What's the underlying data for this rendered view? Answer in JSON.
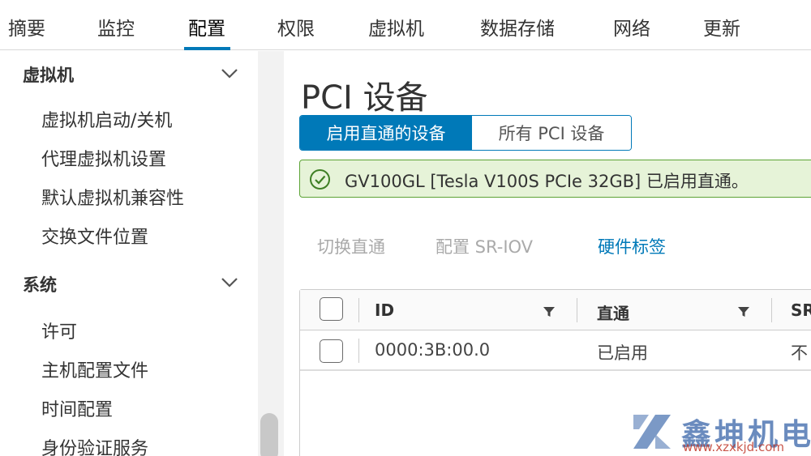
{
  "top_tabs": [
    {
      "label": "摘要"
    },
    {
      "label": "监控"
    },
    {
      "label": "配置",
      "active": true
    },
    {
      "label": "权限"
    },
    {
      "label": "虚拟机"
    },
    {
      "label": "数据存储"
    },
    {
      "label": "网络"
    },
    {
      "label": "更新"
    }
  ],
  "sidebar": {
    "groups": [
      {
        "title": "虚拟机",
        "expanded": true,
        "items": [
          "虚拟机启动/关机",
          "代理虚拟机设置",
          "默认虚拟机兼容性",
          "交换文件位置"
        ]
      },
      {
        "title": "系统",
        "expanded": true,
        "items": [
          "许可",
          "主机配置文件",
          "时间配置",
          "身份验证服务"
        ]
      }
    ]
  },
  "main": {
    "title": "PCI 设备",
    "segmented": {
      "active": "启用直通的设备",
      "inactive": "所有 PCI 设备"
    },
    "alert": {
      "icon": "check-circle-icon",
      "text": "GV100GL [Tesla V100S PCIe 32GB] 已启用直通。"
    },
    "actions": {
      "toggle_passthrough": "切换直通",
      "configure_sriov": "配置 SR-IOV",
      "hardware_label": "硬件标签"
    },
    "grid": {
      "columns": [
        "ID",
        "直通",
        "SR"
      ],
      "rows": [
        {
          "id": "0000:3B:00.0",
          "passthrough": "已启用",
          "sr": "不"
        }
      ]
    }
  },
  "watermark": {
    "brand": "鑫坤机电",
    "url": "www.xzxkjd.com"
  },
  "colors": {
    "accent": "#0079b8",
    "success_bg": "#e6f3d8",
    "success_border": "#5ca335",
    "disabled_text": "#aaaaaa"
  }
}
